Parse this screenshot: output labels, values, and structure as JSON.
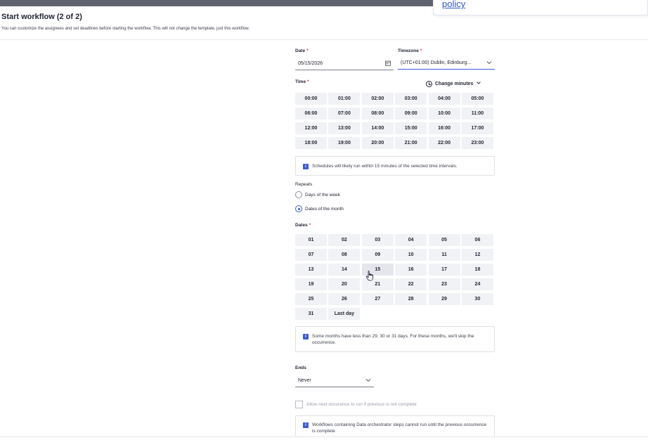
{
  "popover": {
    "link": "policy"
  },
  "header": {
    "title": "Start workflow (2 of 2)",
    "description": "You can customize the assignees and set deadlines before starting the workflow. This will not change the template, just this workflow."
  },
  "date": {
    "label": "Date",
    "required": "*",
    "value": "05/15/2026",
    "icon": "calendar-icon"
  },
  "timezone": {
    "label": "Timezone",
    "required": "*",
    "value": "(UTC+01:00) Dublin, Edinburg...",
    "icon": "chevron-down-icon"
  },
  "time": {
    "label": "Time",
    "required": "*",
    "change_minutes": "Change minutes",
    "slots": [
      "00:00",
      "01:00",
      "02:00",
      "03:00",
      "04:00",
      "05:00",
      "06:00",
      "07:00",
      "08:00",
      "09:00",
      "10:00",
      "11:00",
      "12:00",
      "13:00",
      "14:00",
      "15:00",
      "16:00",
      "17:00",
      "18:00",
      "19:00",
      "20:00",
      "21:00",
      "22:00",
      "23:00"
    ]
  },
  "schedule_note": {
    "text": "Schedules will likely run within 15 minutes of the selected time intervals."
  },
  "repeats": {
    "label": "Repeats",
    "options": [
      {
        "label": "Days of the week",
        "selected": false
      },
      {
        "label": "Dates of the month",
        "selected": true
      }
    ]
  },
  "dates": {
    "label": "Dates",
    "required": "*",
    "items": [
      "01",
      "02",
      "03",
      "04",
      "05",
      "06",
      "07",
      "08",
      "09",
      "10",
      "11",
      "12",
      "13",
      "14",
      "15",
      "16",
      "17",
      "18",
      "19",
      "20",
      "21",
      "22",
      "23",
      "24",
      "25",
      "26",
      "27",
      "28",
      "29",
      "30",
      "31",
      "Last day"
    ]
  },
  "months_note": {
    "text": "Some months have less than 29, 30 or 31 days. For these months, we'll skip the occurrence."
  },
  "ends": {
    "label": "Ends",
    "value": "Never"
  },
  "allow_next": {
    "label": "Allow next occurence to run if previous is not complete",
    "checked": false
  },
  "orchestrator_note": {
    "text": "Workflows containing Data orchestrator steps cannot run until the previous occurrence is complete"
  },
  "colors": {
    "accent": "#3b5bdb",
    "required": "#d8322f",
    "cell_bg": "#f1f2f5"
  }
}
